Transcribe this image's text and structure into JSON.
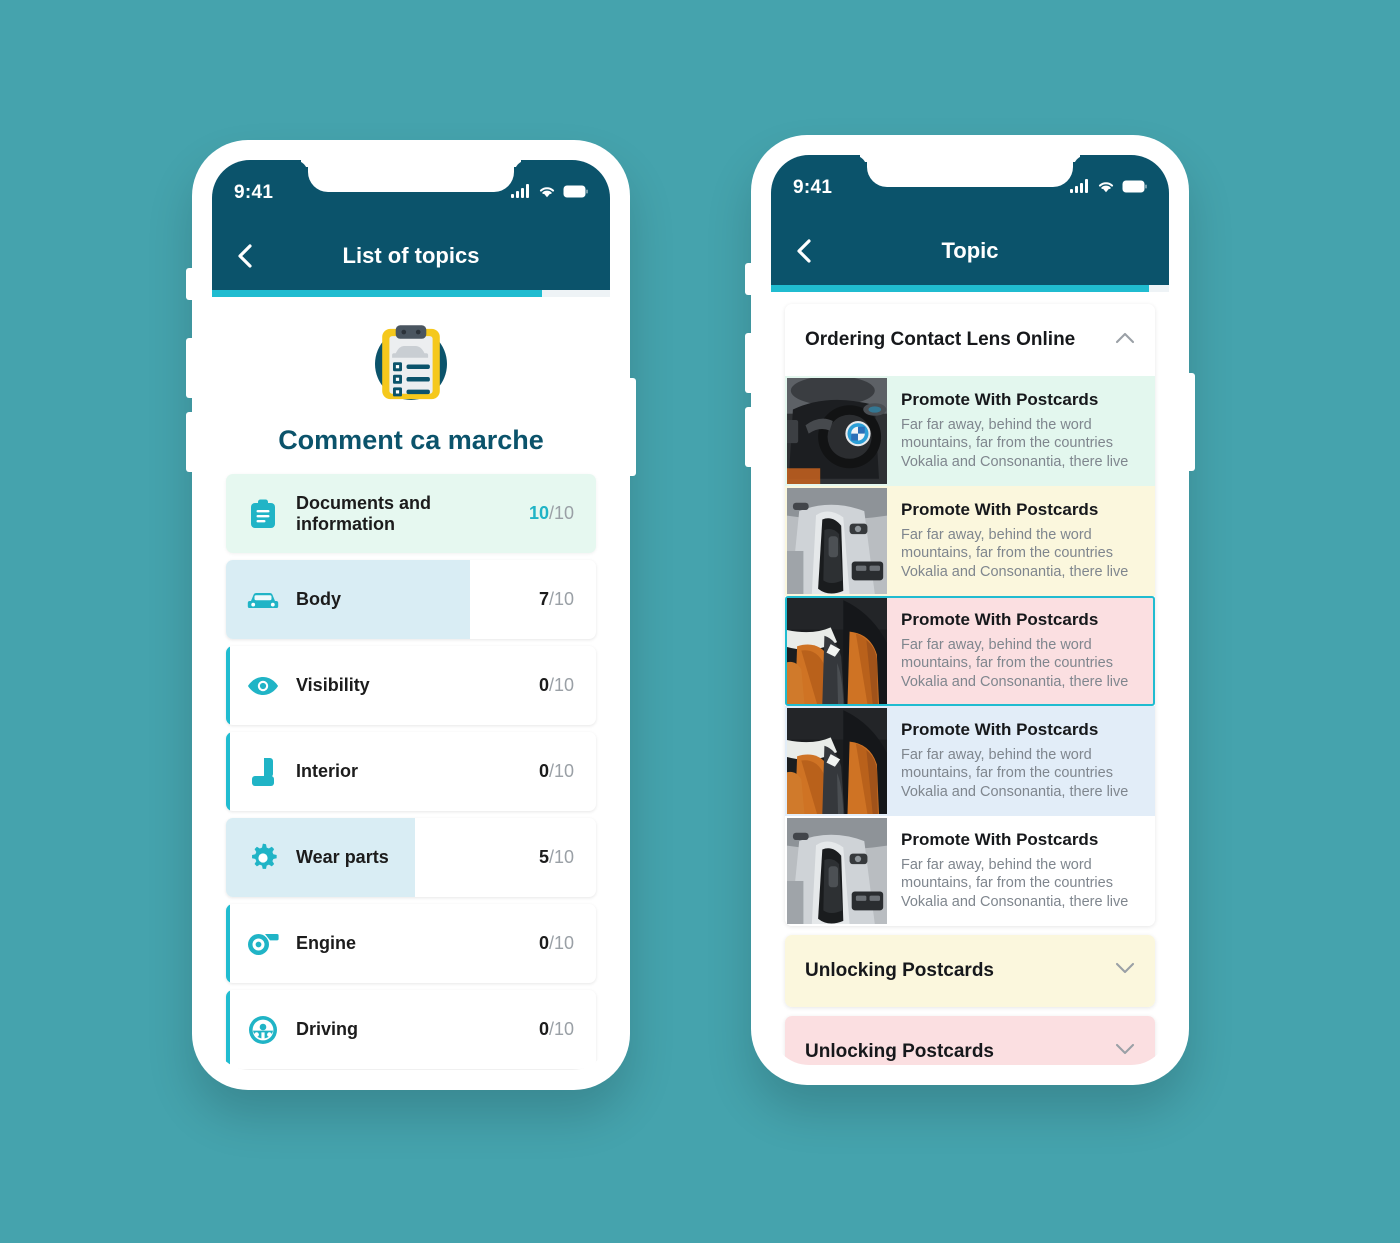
{
  "background_color": "#45a3ad",
  "brand": {
    "navy": "#0b536b",
    "cyan": "#20bcd0",
    "teal_icon": "#20b4c6"
  },
  "left_phone": {
    "status": {
      "time": "9:41",
      "signal_icon": "cellular-bars-icon",
      "wifi_icon": "wifi-icon",
      "battery_icon": "battery-full-icon"
    },
    "nav": {
      "back_icon": "chevron-left-icon",
      "title": "List of topics"
    },
    "progress_percent": 83,
    "hero": {
      "illustration": "clipboard-checklist-car-icon",
      "title": "Comment ca marche"
    },
    "topics": [
      {
        "icon": "clipboard-icon",
        "label": "Documents and information",
        "score": "10",
        "total": "/10",
        "fill_percent": 100,
        "state": "complete"
      },
      {
        "icon": "car-icon",
        "label": "Body",
        "score": "7",
        "total": "/10",
        "fill_percent": 66,
        "state": "partial"
      },
      {
        "icon": "eye-icon",
        "label": "Visibility",
        "score": "0",
        "total": "/10",
        "fill_percent": 0,
        "state": "empty"
      },
      {
        "icon": "car-seat-icon",
        "label": "Interior",
        "score": "0",
        "total": "/10",
        "fill_percent": 0,
        "state": "empty"
      },
      {
        "icon": "gear-icon",
        "label": "Wear parts",
        "score": "5",
        "total": "/10",
        "fill_percent": 51,
        "state": "partial"
      },
      {
        "icon": "turbocharger-icon",
        "label": "Engine",
        "score": "0",
        "total": "/10",
        "fill_percent": 0,
        "state": "empty"
      },
      {
        "icon": "steering-wheel-icon",
        "label": "Driving",
        "score": "0",
        "total": "/10",
        "fill_percent": 0,
        "state": "empty"
      }
    ]
  },
  "right_phone": {
    "status": {
      "time": "9:41",
      "signal_icon": "cellular-bars-icon",
      "wifi_icon": "wifi-icon",
      "battery_icon": "battery-full-icon"
    },
    "nav": {
      "back_icon": "chevron-left-icon",
      "title": "Topic"
    },
    "progress_percent": 95,
    "accordions": [
      {
        "title": "Ordering Contact Lens Online",
        "chevron": "chevron-up-icon",
        "expanded": true,
        "header_tone": "white",
        "items": [
          {
            "title": "Promote With Postcards",
            "desc": "Far far away, behind the word mountains, far from the countries Vokalia and Consonantia, there live",
            "tone": "mint",
            "thumb": "car-steering-wheel-photo",
            "selected": false
          },
          {
            "title": "Promote With Postcards",
            "desc": "Far far away, behind the word mountains, far from the countries Vokalia and Consonantia, there live",
            "tone": "yellow",
            "thumb": "car-gear-shifter-photo",
            "selected": false
          },
          {
            "title": "Promote With Postcards",
            "desc": "Far far away, behind the word mountains, far from the countries Vokalia and Consonantia, there live",
            "tone": "pink",
            "thumb": "car-orange-seats-photo",
            "selected": true
          },
          {
            "title": "Promote With Postcards",
            "desc": "Far far away, behind the word mountains, far from the countries Vokalia and Consonantia, there live",
            "tone": "blue",
            "thumb": "car-orange-seats-photo",
            "selected": false
          },
          {
            "title": "Promote With Postcards",
            "desc": "Far far away, behind the word mountains, far from the countries Vokalia and Consonantia, there live",
            "tone": "white",
            "thumb": "car-gear-shifter-photo",
            "selected": false
          }
        ]
      },
      {
        "title": "Unlocking Postcards",
        "chevron": "chevron-down-icon",
        "expanded": false,
        "header_tone": "yellow",
        "items": []
      },
      {
        "title": "Unlocking Postcards",
        "chevron": "chevron-down-icon",
        "expanded": false,
        "header_tone": "pink",
        "items": []
      }
    ],
    "partial_accordion_tone": "mint"
  }
}
